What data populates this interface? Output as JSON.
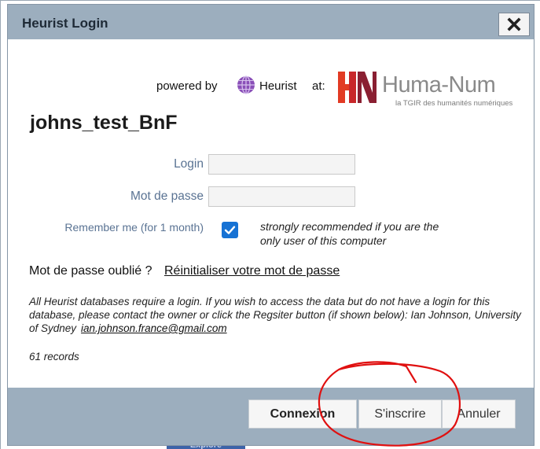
{
  "dialog": {
    "title": "Heurist Login",
    "close_icon": "close-x-icon"
  },
  "branding": {
    "powered_by": "powered by",
    "heurist_name": "Heurist",
    "at": "at:",
    "huma_num_name": "Huma-Num",
    "huma_num_tagline": "la TGIR des humanités numériques",
    "heurist_icon": "globe-icon",
    "huma_num_colors": [
      "#e23b24",
      "#c8272a",
      "#8a1f32"
    ]
  },
  "database_name": "johns_test_BnF",
  "form": {
    "login_label": "Login",
    "login_value": "",
    "password_label": "Mot de passe",
    "password_value": "",
    "remember_label": "Remember me (for 1 month)",
    "remember_checked": true,
    "remember_hint": "strongly recommended if you are the only user of this computer"
  },
  "forgot": {
    "text": "Mot de passe oublié ?",
    "link": "Réinitialiser votre mot de passe"
  },
  "note": {
    "text": "All Heurist databases require a login. If you wish to access the data but do not have a login for this database, please contact the owner or click the Regsiter button (if shown below): Ian Johnson, University of Sydney",
    "email": "ian.johnson.france@gmail.com"
  },
  "records": "61 records",
  "buttons": {
    "connexion": "Connexion",
    "inscrire": "S'inscrire",
    "annuler": "Annuler"
  },
  "background": {
    "tab_label": "Explore"
  },
  "colors": {
    "dialog_chrome": "#9caebe",
    "label_blue": "#5a7393",
    "checkbox_blue": "#1672d4",
    "annotation_red": "#e01010"
  }
}
